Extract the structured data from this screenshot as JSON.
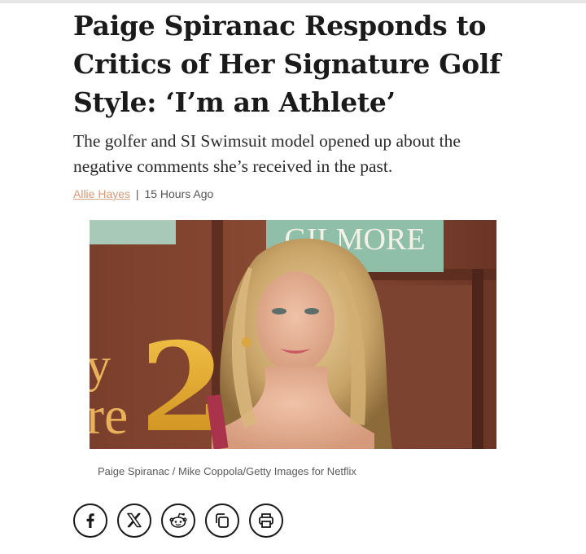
{
  "article": {
    "headline": "Paige Spiranac Responds to Critics of Her Signature Golf Style: ‘I’m an Athlete’",
    "dek": "The golfer and SI Swimsuit model opened up about the negative comments she’s received in the past.",
    "author": "Allie Hayes",
    "separator": "|",
    "timestamp": "15 Hours Ago"
  },
  "hero_image": {
    "backdrop_text_top": "GILMORE",
    "backdrop_text_left_1": "y",
    "backdrop_text_left_2": "re",
    "backdrop_number": "2",
    "caption": "Paige Spiranac / Mike Coppola/Getty Images for Netflix"
  },
  "share": {
    "icons": [
      "facebook-icon",
      "x-icon",
      "reddit-icon",
      "copy-link-icon",
      "print-icon"
    ]
  },
  "colors": {
    "author_link": "#d39a78",
    "text": "#1a1a1a",
    "caption": "#5b5b5b"
  }
}
